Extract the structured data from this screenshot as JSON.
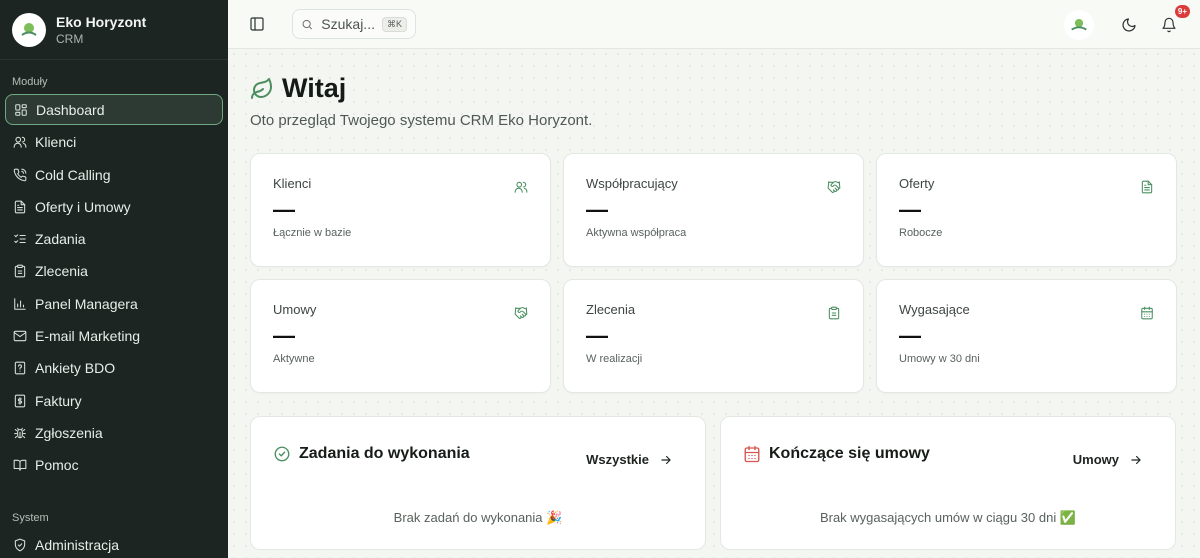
{
  "brand": {
    "name": "Eko Horyzont",
    "sub": "CRM"
  },
  "sidebar": {
    "section_modules": "Moduły",
    "section_system": "System",
    "items": [
      {
        "label": "Dashboard",
        "icon": "dashboard-icon"
      },
      {
        "label": "Klienci",
        "icon": "users-icon"
      },
      {
        "label": "Cold Calling",
        "icon": "phone-icon"
      },
      {
        "label": "Oferty i Umowy",
        "icon": "file-text-icon"
      },
      {
        "label": "Zadania",
        "icon": "list-checks-icon"
      },
      {
        "label": "Zlecenia",
        "icon": "clipboard-icon"
      },
      {
        "label": "Panel Managera",
        "icon": "bar-chart-icon"
      },
      {
        "label": "E-mail Marketing",
        "icon": "mail-icon"
      },
      {
        "label": "Ankiety BDO",
        "icon": "help-file-icon"
      },
      {
        "label": "Faktury",
        "icon": "dollar-file-icon"
      },
      {
        "label": "Zgłoszenia",
        "icon": "bug-icon"
      },
      {
        "label": "Pomoc",
        "icon": "book-icon"
      }
    ],
    "system_items": [
      {
        "label": "Administracja",
        "icon": "shield-icon"
      }
    ]
  },
  "topbar": {
    "search_placeholder": "Szukaj...",
    "search_shortcut": "⌘K",
    "notification_count": "9+"
  },
  "main": {
    "title": "Witaj",
    "subtitle": "Oto przegląd Twojego systemu CRM Eko Horyzont.",
    "stats": [
      {
        "title": "Klienci",
        "value": "—",
        "desc": "Łącznie w bazie",
        "icon": "users-icon"
      },
      {
        "title": "Współpracujący",
        "value": "—",
        "desc": "Aktywna współpraca",
        "icon": "handshake-icon"
      },
      {
        "title": "Oferty",
        "value": "—",
        "desc": "Robocze",
        "icon": "file-text-icon"
      },
      {
        "title": "Umowy",
        "value": "—",
        "desc": "Aktywne",
        "icon": "handshake-icon"
      },
      {
        "title": "Zlecenia",
        "value": "—",
        "desc": "W realizacji",
        "icon": "clipboard-icon"
      },
      {
        "title": "Wygasające",
        "value": "—",
        "desc": "Umowy w 30 dni",
        "icon": "calendar-icon"
      }
    ],
    "tasks_panel": {
      "title": "Zadania do wykonania",
      "link": "Wszystkie",
      "empty": "Brak zadań do wykonania 🎉"
    },
    "contracts_panel": {
      "title": "Kończące się umowy",
      "link": "Umowy",
      "empty": "Brak wygasających umów w ciągu 30 dni ✅"
    }
  },
  "colors": {
    "sidebar_bg": "#1c2521",
    "accent": "#4b8f61",
    "active_border": "#6fa883",
    "badge": "#dd3b3b",
    "calendar_red": "#d9534f"
  }
}
